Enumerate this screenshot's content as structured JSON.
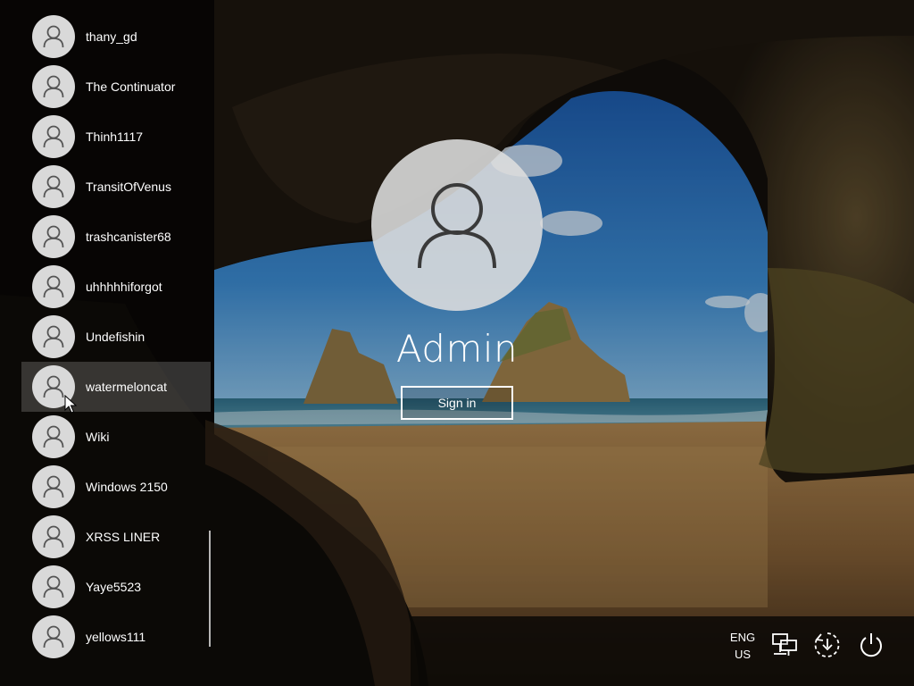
{
  "users": [
    {
      "name": "thany_gd"
    },
    {
      "name": "The Continuator"
    },
    {
      "name": "Thinh1117"
    },
    {
      "name": "TransitOfVenus"
    },
    {
      "name": "trashcanister68"
    },
    {
      "name": "uhhhhhiforgot"
    },
    {
      "name": "Undefishin"
    },
    {
      "name": "watermeloncat",
      "hovered": true
    },
    {
      "name": "Wiki"
    },
    {
      "name": "Windows 2150"
    },
    {
      "name": "XRSS LINER"
    },
    {
      "name": "Yaye5523"
    },
    {
      "name": "yellows111"
    }
  ],
  "login": {
    "username": "Admin",
    "signin_label": "Sign in"
  },
  "tray": {
    "language_line1": "ENG",
    "language_line2": "US",
    "network_icon": "network-icon",
    "ease_icon": "ease-of-access-icon",
    "power_icon": "power-icon"
  },
  "colors": {
    "avatar_bg": "#d9d9d9",
    "avatar_glyph": "#555555",
    "hover_bg": "#ffffff2e",
    "text": "#ffffff"
  }
}
